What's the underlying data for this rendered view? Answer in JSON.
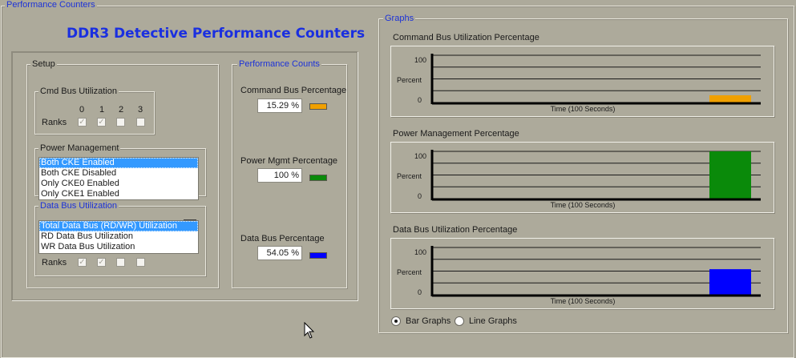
{
  "perf_counters_legend": "Performance Counters",
  "main_title": "DDR3 Detective Performance Counters",
  "setup": {
    "legend": "Setup",
    "cmd_bus": {
      "legend": "Cmd Bus Utilization",
      "rank_numbers": [
        "0",
        "1",
        "2",
        "3"
      ],
      "ranks_label": "Ranks",
      "checked": [
        true,
        true,
        false,
        false
      ]
    },
    "power_mgmt": {
      "legend": "Power Management",
      "options": [
        "Both CKE Enabled",
        "Both CKE Disabled",
        "Only CKE0 Enabled",
        "Only CKE1 Enabled"
      ],
      "selected_index": 0
    },
    "data_bus": {
      "legend": "Data Bus Utilization",
      "options": [
        "Total Data Bus (RD/WR) Utilization",
        "RD Data Bus Utilization",
        "WR Data Bus Utilization"
      ],
      "selected_index": 0,
      "ranks_label": "Ranks",
      "checked": [
        true,
        true,
        false,
        false
      ]
    }
  },
  "perf_counts": {
    "legend": "Performance Counts",
    "command": {
      "label": "Command Bus Percentage",
      "value": "15.29 %",
      "color": "#f0a000"
    },
    "power": {
      "label": "Power Mgmt Percentage",
      "value": "100 %",
      "color": "#0a8a0a"
    },
    "data": {
      "label": "Data Bus Percentage",
      "value": "54.05 %",
      "color": "#0000ff"
    }
  },
  "graphs": {
    "legend": "Graphs",
    "panels": [
      {
        "title": "Command Bus Utilization Percentage",
        "y_max_label": "100",
        "y_label": "Percent",
        "y_min_label": "0",
        "x_label": "Time (100 Seconds)",
        "value": 15.29,
        "color": "#f0a000"
      },
      {
        "title": "Power Management Percentage",
        "y_max_label": "100",
        "y_label": "Percent",
        "y_min_label": "0",
        "x_label": "Time (100 Seconds)",
        "value": 100,
        "color": "#0a8a0a"
      },
      {
        "title": "Data Bus Utilization Percentage",
        "y_max_label": "100",
        "y_label": "Percent",
        "y_min_label": "0",
        "x_label": "Time (100 Seconds)",
        "value": 54.05,
        "color": "#0000ff"
      }
    ],
    "mode": {
      "bar_label": "Bar Graphs",
      "line_label": "Line Graphs",
      "selected": "bar"
    }
  }
}
